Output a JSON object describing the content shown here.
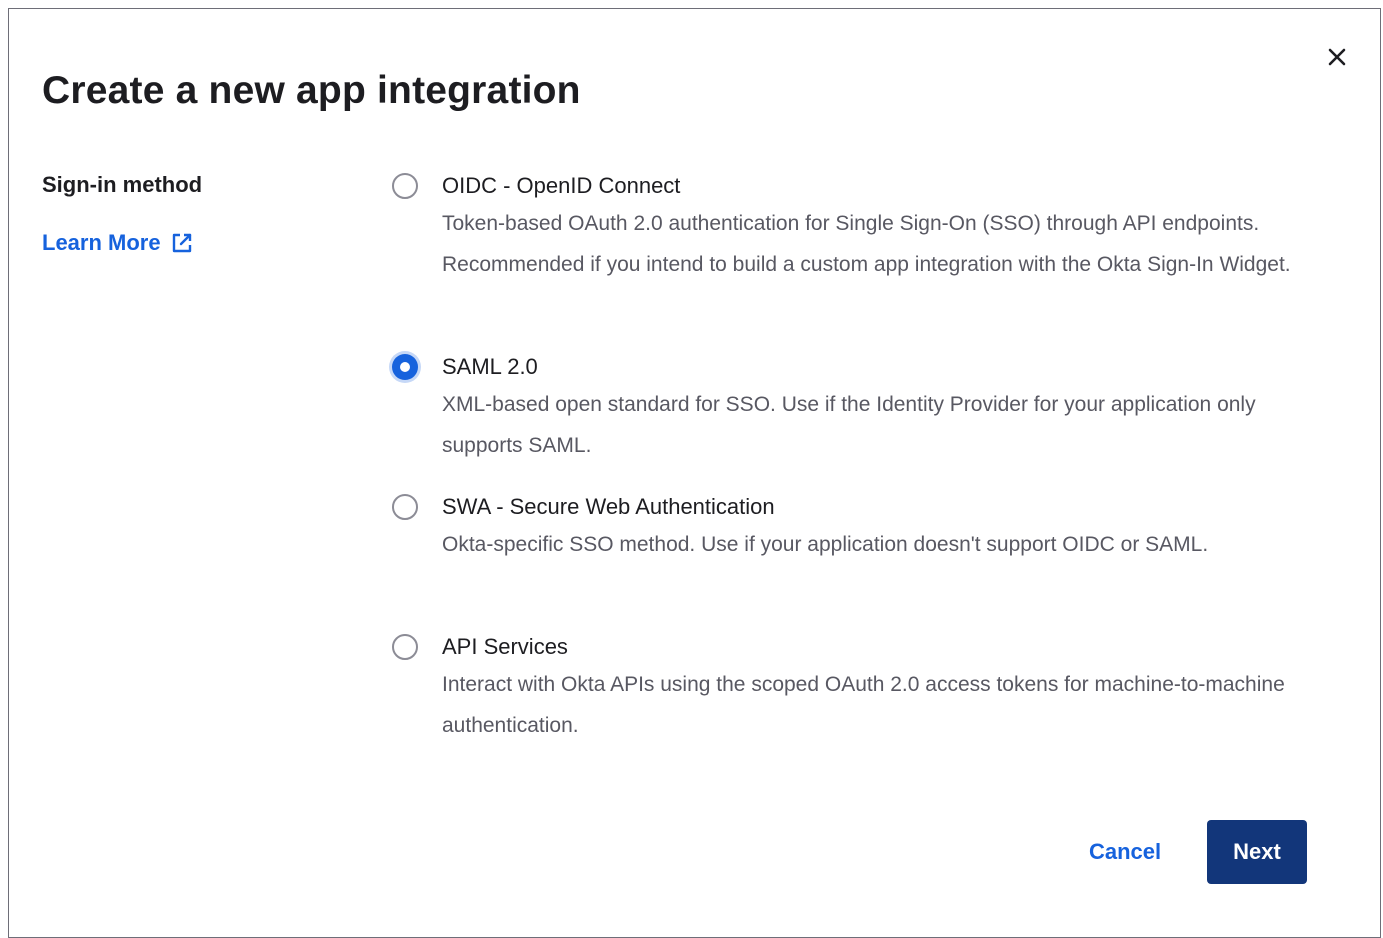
{
  "dialog": {
    "title": "Create a new app integration",
    "close_icon": "close-icon"
  },
  "sidebar": {
    "label": "Sign-in method",
    "learn_more": "Learn More",
    "learn_more_icon": "external-link-icon"
  },
  "options": [
    {
      "label": "OIDC - OpenID Connect",
      "description": "Token-based OAuth 2.0 authentication for Single Sign-On (SSO) through API endpoints. Recommended if you intend to build a custom app integration with the Okta Sign-In Widget.",
      "selected": false
    },
    {
      "label": "SAML 2.0",
      "description": "XML-based open standard for SSO. Use if the Identity Provider for your application only supports SAML.",
      "selected": true
    },
    {
      "label": "SWA - Secure Web Authentication",
      "description": "Okta-specific SSO method. Use if your application doesn't support OIDC or SAML.",
      "selected": false
    },
    {
      "label": "API Services",
      "description": "Interact with Okta APIs using the scoped OAuth 2.0 access tokens for machine-to-machine authentication.",
      "selected": false
    }
  ],
  "footer": {
    "cancel_label": "Cancel",
    "next_label": "Next"
  },
  "colors": {
    "accent": "#1662dd",
    "primary_button": "#12367a",
    "text": "#1d1d21",
    "muted_text": "#585862"
  }
}
